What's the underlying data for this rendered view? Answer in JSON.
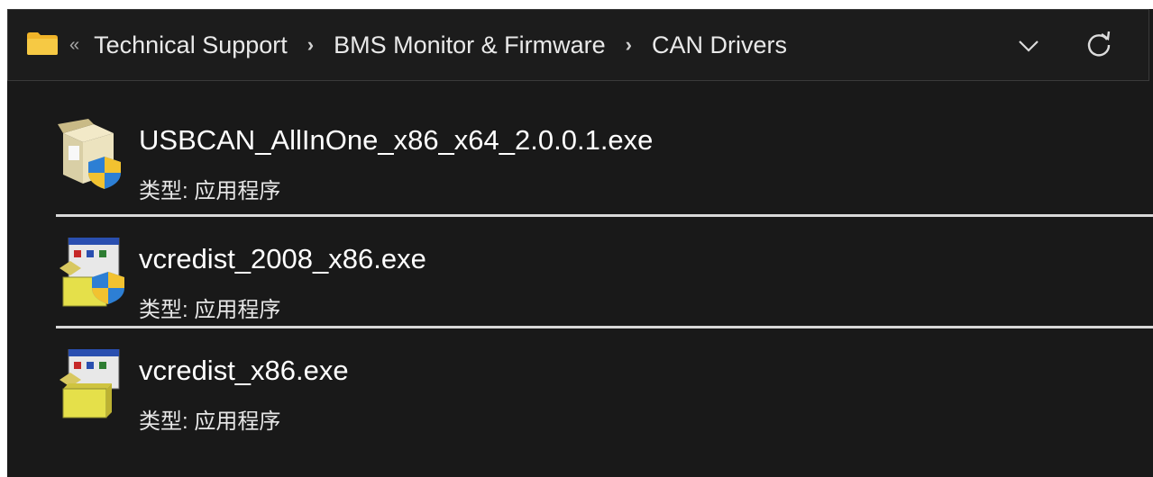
{
  "addressbar": {
    "overflow": "«",
    "crumbs": [
      "Technical Support",
      "BMS Monitor & Firmware",
      "CAN Drivers"
    ],
    "separator": "›"
  },
  "files": [
    {
      "name": "USBCAN_AllInOne_x86_x64_2.0.0.1.exe",
      "type": "类型: 应用程序",
      "icon": "installer-box-shield-icon"
    },
    {
      "name": "vcredist_2008_x86.exe",
      "type": "类型: 应用程序",
      "icon": "installer-window-shield-icon"
    },
    {
      "name": "vcredist_x86.exe",
      "type": "类型: 应用程序",
      "icon": "installer-window-box-icon"
    }
  ],
  "colors": {
    "background": "#191919",
    "folder": "#f2c230",
    "text": "#ffffff",
    "divider": "#d8d8d8"
  }
}
